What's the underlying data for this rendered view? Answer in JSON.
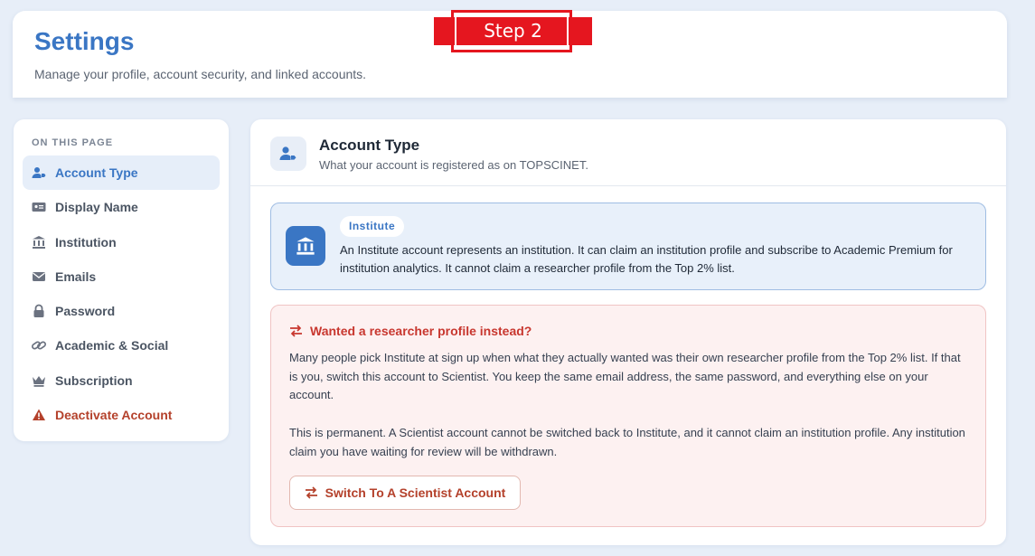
{
  "header": {
    "title": "Settings",
    "subtitle": "Manage your profile, account security, and linked accounts."
  },
  "annotation": {
    "step_label": "Step 2"
  },
  "sidebar": {
    "section_label": "ON THIS PAGE",
    "items": [
      {
        "label": "Account Type",
        "icon": "user-tag-icon",
        "active": true
      },
      {
        "label": "Display Name",
        "icon": "id-card-icon"
      },
      {
        "label": "Institution",
        "icon": "building-columns-icon"
      },
      {
        "label": "Emails",
        "icon": "envelope-icon"
      },
      {
        "label": "Password",
        "icon": "lock-icon"
      },
      {
        "label": "Academic & Social",
        "icon": "link-icon"
      },
      {
        "label": "Subscription",
        "icon": "crown-icon"
      },
      {
        "label": "Deactivate Account",
        "icon": "warning-icon",
        "danger": true
      }
    ]
  },
  "main": {
    "title": "Account Type",
    "subtitle": "What your account is registered as on TOPSCINET.",
    "info": {
      "badge": "Institute",
      "text": "An Institute account represents an institution. It can claim an institution profile and subscribe to Academic Premium for institution analytics. It cannot claim a researcher profile from the Top 2% list."
    },
    "warning": {
      "title": "Wanted a researcher profile instead?",
      "paragraph1": "Many people pick Institute at sign up when what they actually wanted was their own researcher profile from the Top 2% list. If that is you, switch this account to Scientist. You keep the same email address, the same password, and everything else on your account.",
      "paragraph2": "This is permanent. A Scientist account cannot be switched back to Institute, and it cannot claim an institution profile. Any institution claim you have waiting for review will be withdrawn.",
      "button_label": "Switch To A Scientist Account"
    }
  },
  "colors": {
    "accent": "#3a76c4",
    "danger": "#c8372f",
    "annotation_red": "#e5161f",
    "page_bg": "#e7eef8"
  }
}
